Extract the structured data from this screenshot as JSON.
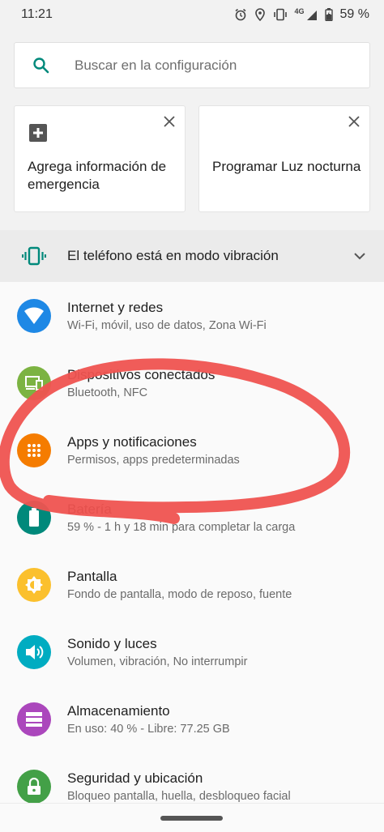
{
  "status_bar": {
    "time": "11:21",
    "network": "4G",
    "battery": "59 %",
    "icons": [
      "alarm-icon",
      "location-icon",
      "vibrate-icon",
      "signal-icon",
      "battery-icon"
    ]
  },
  "search": {
    "placeholder": "Buscar en la configuración",
    "icon": "search-icon"
  },
  "suggestions": [
    {
      "label": "Agrega información de emergencia",
      "icon": "plus-box-icon"
    },
    {
      "label": "Programar Luz nocturna",
      "icon": "moon-icon"
    }
  ],
  "condition": {
    "label": "El teléfono está en modo vibración",
    "icon": "vibrate-icon"
  },
  "settings": [
    {
      "title": "Internet y redes",
      "subtitle": "Wi-Fi, móvil, uso de datos, Zona Wi-Fi",
      "icon": "wifi-icon",
      "color": "#1e88e5"
    },
    {
      "title": "Dispositivos conectados",
      "subtitle": "Bluetooth, NFC",
      "icon": "devices-icon",
      "color": "#7cb342"
    },
    {
      "title": "Apps y notificaciones",
      "subtitle": "Permisos, apps predeterminadas",
      "icon": "apps-icon",
      "color": "#f57c00"
    },
    {
      "title": "Batería",
      "subtitle": "59 % - 1 h y 18 min para completar la carga",
      "icon": "battery-icon",
      "color": "#00897b"
    },
    {
      "title": "Pantalla",
      "subtitle": "Fondo de pantalla, modo de reposo, fuente",
      "icon": "brightness-icon",
      "color": "#fbc02d"
    },
    {
      "title": "Sonido y luces",
      "subtitle": "Volumen, vibración, No interrumpir",
      "icon": "volume-icon",
      "color": "#00acc1"
    },
    {
      "title": "Almacenamiento",
      "subtitle": "En uso: 40 % - Libre: 77.25 GB",
      "icon": "storage-icon",
      "color": "#ab47bc"
    },
    {
      "title": "Seguridad y ubicación",
      "subtitle": "Bloqueo pantalla, huella, desbloqueo facial",
      "icon": "lock-icon",
      "color": "#43a047"
    }
  ],
  "colors": {
    "accent": "#00897b",
    "scribble": "#ef5350"
  }
}
